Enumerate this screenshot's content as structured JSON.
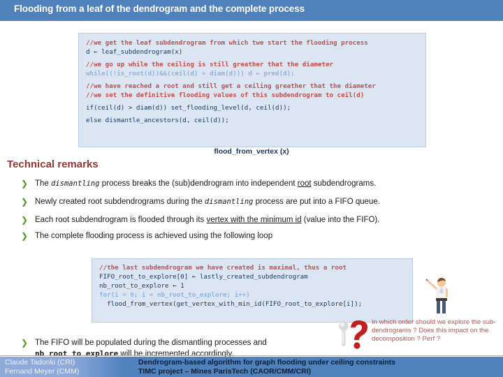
{
  "slide": {
    "title": "Flooding from a leaf of the dendrogram and the complete process"
  },
  "code_block_1": {
    "caption": "flood_from_vertex (x)",
    "lines": [
      {
        "type": "comment",
        "text": "//we get the leaf subdendrogram from which twe start the flooding process"
      },
      {
        "type": "code",
        "text": "d ← leaf_subdendrogram(x)"
      },
      {
        "type": "comment",
        "text": "//we go up while the ceiling is still greather that the diameter"
      },
      {
        "type": "code",
        "text": "while((!is_root(d))&&(ceil(d) > diam(d))) d ← pred(d);"
      },
      {
        "type": "comment",
        "text": "//we have reached a root and still get a ceiling greather that the diameter"
      },
      {
        "type": "comment",
        "text": "//we set the definitive flooding values of this subdendrogram to ceil(d)"
      },
      {
        "type": "code",
        "text": "if(ceil(d) > diam(d)) set_flooding_level(d, ceil(d));"
      },
      {
        "type": "code",
        "text": "else dismantle_ancestors(d, ceil(d));"
      }
    ]
  },
  "code_block_2": {
    "lines": [
      {
        "type": "comment",
        "text": "//the last subdendrogram we have created is maximal, thus a root"
      },
      {
        "type": "code",
        "text": "FIFO_root_to_explore[0] ← lastly_created_subdendrogram"
      },
      {
        "type": "code",
        "text": "nb_root_to_explore ← 1"
      },
      {
        "type": "code",
        "text": "for(i = 0; i < nb_root_to_explore; i++)"
      },
      {
        "type": "code",
        "text": "  flood_from_vertex(get_vertex_with_min_id(FIFO_root_to_explore[i]);"
      }
    ]
  },
  "remarks": {
    "heading": "Technical remarks",
    "bullet_glyph": "❯",
    "items": [
      {
        "parts": [
          {
            "style": "normal",
            "text": "The "
          },
          {
            "style": "mono",
            "text": "dismantling"
          },
          {
            "style": "normal",
            "text": " process breaks the (sub)dendrogram into independent "
          },
          {
            "style": "underline",
            "text": "root"
          },
          {
            "style": "normal",
            "text": " subdendrograms."
          }
        ]
      },
      {
        "parts": [
          {
            "style": "normal",
            "text": "Newly created root subdendrograms during the "
          },
          {
            "style": "mono",
            "text": "dismantling"
          },
          {
            "style": "normal",
            "text": " process are put into a FIFO queue."
          }
        ]
      },
      {
        "parts": [
          {
            "style": "normal",
            "text": "Each root subdendrogram is flooded through its "
          },
          {
            "style": "underline",
            "text": "vertex with the minimum id"
          },
          {
            "style": "normal",
            "text": " (value into the FIFO)."
          }
        ]
      },
      {
        "parts": [
          {
            "style": "normal",
            "text": "The complete flooding process is achieved using the following loop"
          }
        ]
      },
      {
        "parts": [
          {
            "style": "normal",
            "text": "The FIFO will be populated during the dismantling processes and "
          },
          {
            "style": "monobold",
            "text": "nb_root_to_explore"
          },
          {
            "style": "normal",
            "text": " will be incremented accordingly."
          }
        ]
      }
    ]
  },
  "question": {
    "icon": "question-mark-icon",
    "text": "In which order should we explore the sub-dendrograms ? Does this impact on the decomposition ? Perf ?"
  },
  "presenter": {
    "icon": "presenter-person-icon"
  },
  "footer": {
    "author_line_1": "Claude Tadonki (CRI)",
    "author_line_2": "Fernand Meyer (CMM)",
    "title_line_1": "Dendrogram-based algorithm for graph flooding under ceiling constraints",
    "title_line_2": "TIMC project – Mines ParisTech (CAOR/CMM/CRI)"
  },
  "colors": {
    "header_blue": "#4f81bd",
    "code_bg": "#dce6f2",
    "comment_red": "#c0504d",
    "heading_maroon": "#943634",
    "bullet_green": "#4e9a1f",
    "code_ink": "#17375e"
  }
}
